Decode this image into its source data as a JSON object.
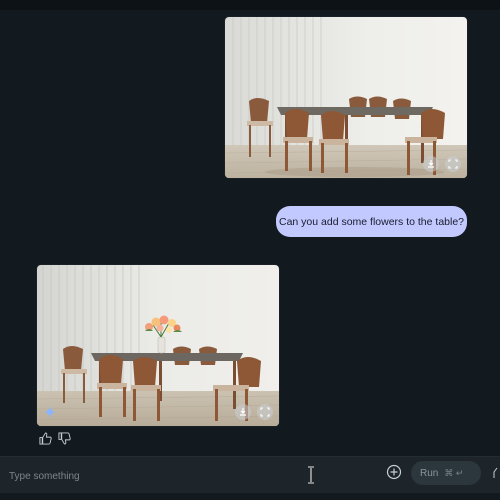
{
  "messages": {
    "user_prompt": "Can you add some flowers to the table?"
  },
  "composer": {
    "placeholder": "Type something",
    "run_label": "Run",
    "shortcut_label": "⌘ ↵"
  },
  "colors": {
    "background": "#131a1f",
    "user_bubble": "#c2c9ff",
    "composer_bg": "#1d252b",
    "accent_sparkle": "#8ab4ff"
  },
  "icons": {
    "download": "download-icon",
    "fullscreen": "fullscreen-icon",
    "sparkle": "sparkle-icon",
    "thumbs_up": "thumbs-up-icon",
    "thumbs_down": "thumbs-down-icon",
    "add": "add-circle-icon",
    "text_cursor": "text-cursor-icon"
  }
}
